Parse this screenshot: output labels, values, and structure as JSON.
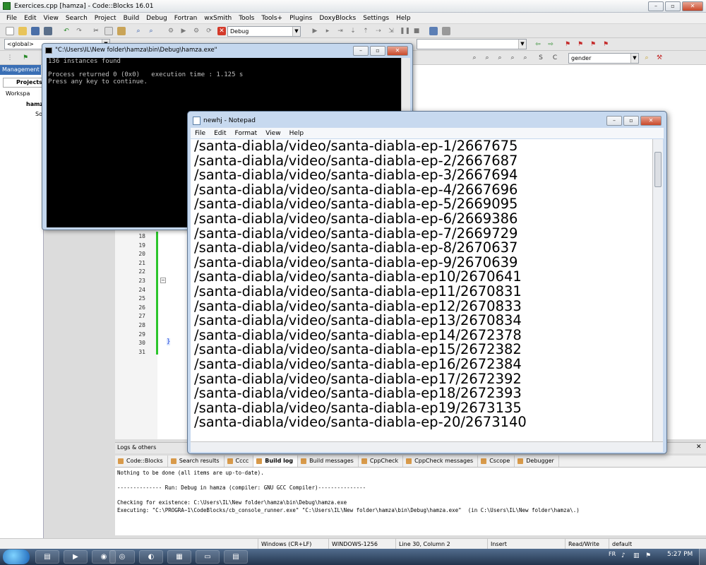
{
  "codeblocks": {
    "window_title": "Exercices.cpp [hamza] - Code::Blocks 16.01",
    "menu": [
      "File",
      "Edit",
      "View",
      "Search",
      "Project",
      "Build",
      "Debug",
      "Fortran",
      "wxSmith",
      "Tools",
      "Tools+",
      "Plugins",
      "DoxyBlocks",
      "Settings",
      "Help"
    ],
    "build_target": "Debug",
    "scope_combo": "<global>",
    "search_combo": "gender",
    "management_tab": "Management",
    "projects_tab": "Projects",
    "tree": [
      "Workspa",
      "hamz",
      "So"
    ],
    "line_numbers": [
      "18",
      "19",
      "20",
      "21",
      "22",
      "23",
      "24",
      "25",
      "26",
      "27",
      "28",
      "29",
      "30",
      "31"
    ],
    "logs_title": "Logs & others",
    "log_tabs": [
      "Code::Blocks",
      "Search results",
      "Cccc",
      "Build log",
      "Build messages",
      "CppCheck",
      "CppCheck messages",
      "Cscope",
      "Debugger"
    ],
    "log_lines": [
      "Nothing to be done (all items are up-to-date).",
      "",
      "-------------- Run: Debug in hamza (compiler: GNU GCC Compiler)---------------",
      "",
      "Checking for existence: C:\\Users\\IL\\New folder\\hamza\\bin\\Debug\\hamza.exe",
      "Executing: \"C:\\PROGRA~1\\CodeBlocks/cb_console_runner.exe\" \"C:\\Users\\IL\\New folder\\hamza\\bin\\Debug\\hamza.exe\"  (in C:\\Users\\IL\\New folder\\hamza\\.)"
    ],
    "status": {
      "line_endings": "Windows (CR+LF)",
      "encoding": "WINDOWS-1256",
      "position": "Line 30, Column 2",
      "mode": "Insert",
      "access": "Read/Write",
      "theme": "default"
    }
  },
  "console": {
    "title": "\"C:\\Users\\IL\\New folder\\hamza\\bin\\Debug\\hamza.exe\"",
    "lines": [
      "136 instances found",
      "",
      "Process returned 0 (0x0)   execution time : 1.125 s",
      "Press any key to continue."
    ]
  },
  "notepad": {
    "title": "newhj - Notepad",
    "menu": [
      "File",
      "Edit",
      "Format",
      "View",
      "Help"
    ],
    "lines": [
      "/santa-diabla/video/santa-diabla-ep-1/2667675",
      "/santa-diabla/video/santa-diabla-ep-2/2667687",
      "/santa-diabla/video/santa-diabla-ep-3/2667694",
      "/santa-diabla/video/santa-diabla-ep-4/2667696",
      "/santa-diabla/video/santa-diabla-ep-5/2669095",
      "/santa-diabla/video/santa-diabla-ep-6/2669386",
      "/santa-diabla/video/santa-diabla-ep-7/2669729",
      "/santa-diabla/video/santa-diabla-ep-8/2670637",
      "/santa-diabla/video/santa-diabla-ep-9/2670639",
      "/santa-diabla/video/santa-diabla-ep10/2670641",
      "/santa-diabla/video/santa-diabla-ep11/2670831",
      "/santa-diabla/video/santa-diabla-ep12/2670833",
      "/santa-diabla/video/santa-diabla-ep13/2670834",
      "/santa-diabla/video/santa-diabla-ep14/2672378",
      "/santa-diabla/video/santa-diabla-ep15/2672382",
      "/santa-diabla/video/santa-diabla-ep16/2672384",
      "/santa-diabla/video/santa-diabla-ep17/2672392",
      "/santa-diabla/video/santa-diabla-ep18/2672393",
      "/santa-diabla/video/santa-diabla-ep19/2673135",
      "/santa-diabla/video/santa-diabla-ep-20/2673140"
    ]
  },
  "taskbar": {
    "language": "FR",
    "clock": "5:27 PM"
  }
}
